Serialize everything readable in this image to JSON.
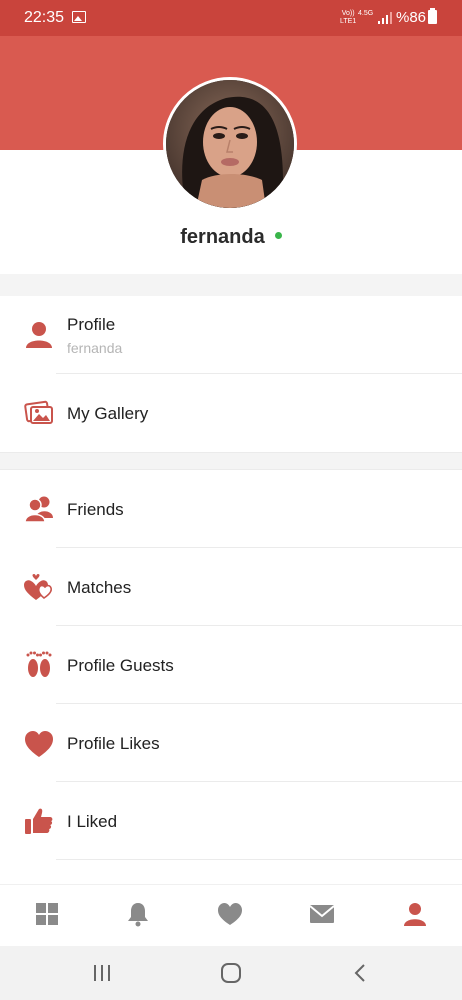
{
  "status_bar": {
    "time": "22:35",
    "network_top": "Vo))",
    "network_bottom": "LTE1",
    "network2_top": "4.5G",
    "battery_text": "%86"
  },
  "profile": {
    "username": "fernanda",
    "online": true
  },
  "menu": {
    "section1": [
      {
        "label": "Profile",
        "sublabel": "fernanda",
        "icon": "person-icon"
      },
      {
        "label": "My Gallery",
        "icon": "gallery-icon"
      }
    ],
    "section2": [
      {
        "label": "Friends",
        "icon": "friends-icon"
      },
      {
        "label": "Matches",
        "icon": "matches-icon"
      },
      {
        "label": "Profile Guests",
        "icon": "footprints-icon"
      },
      {
        "label": "Profile Likes",
        "icon": "heart-icon"
      },
      {
        "label": "I Liked",
        "icon": "thumbs-up-icon"
      }
    ]
  },
  "tabbar": {
    "tabs": [
      "grid-icon",
      "bell-icon",
      "heart-icon",
      "mail-icon",
      "person-icon"
    ],
    "active": "person-icon"
  },
  "colors": {
    "accent": "#c9443c",
    "header": "#d95a50",
    "icon": "#c9544c",
    "tab_inactive": "#8a8a8a",
    "online": "#39b54a"
  }
}
